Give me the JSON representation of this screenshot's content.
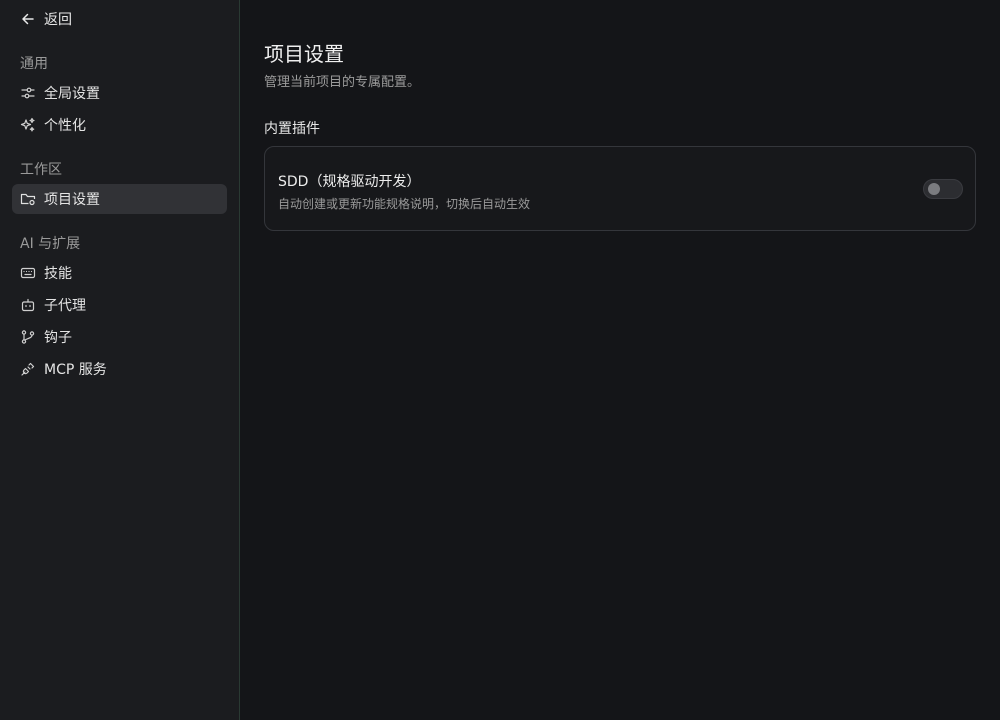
{
  "sidebar": {
    "back_label": "返回",
    "sections": [
      {
        "label": "通用",
        "items": [
          {
            "label": "全局设置",
            "icon": "sliders-icon"
          },
          {
            "label": "个性化",
            "icon": "sparkles-icon"
          }
        ]
      },
      {
        "label": "工作区",
        "items": [
          {
            "label": "项目设置",
            "icon": "folder-settings-icon",
            "active": true
          }
        ]
      },
      {
        "label": "AI 与扩展",
        "items": [
          {
            "label": "技能",
            "icon": "keyboard-icon"
          },
          {
            "label": "子代理",
            "icon": "bot-icon"
          },
          {
            "label": "钩子",
            "icon": "git-branch-icon"
          },
          {
            "label": "MCP 服务",
            "icon": "plug-icon"
          }
        ]
      }
    ]
  },
  "main": {
    "title": "项目设置",
    "subtitle": "管理当前项目的专属配置。",
    "section_heading": "内置插件",
    "plugins": [
      {
        "name": "SDD（规格驱动开发）",
        "description": "自动创建或更新功能规格说明，切换后自动生效",
        "enabled": false
      }
    ]
  },
  "colors": {
    "background": "#141518",
    "sidebar_background": "#1b1c1f",
    "active_item": "#313236",
    "toggle_off": "#2c2d31"
  }
}
